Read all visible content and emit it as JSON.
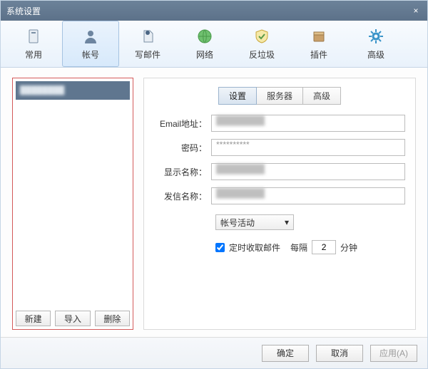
{
  "window": {
    "title": "系统设置",
    "close": "×"
  },
  "toolbar": {
    "items": [
      {
        "label": "常用",
        "icon": "general-icon"
      },
      {
        "label": "帐号",
        "icon": "account-icon",
        "active": true
      },
      {
        "label": "写邮件",
        "icon": "compose-icon"
      },
      {
        "label": "网络",
        "icon": "network-icon"
      },
      {
        "label": "反垃圾",
        "icon": "antispam-icon"
      },
      {
        "label": "插件",
        "icon": "plugin-icon"
      },
      {
        "label": "高级",
        "icon": "advanced-icon"
      }
    ]
  },
  "sidebar": {
    "accounts": [
      {
        "display": "████████"
      }
    ],
    "buttons": {
      "new": "新建",
      "import": "导入",
      "delete": "删除"
    }
  },
  "subtabs": {
    "settings": "设置",
    "server": "服务器",
    "advanced": "高级"
  },
  "form": {
    "email_label": "Email地址：",
    "email_value": "████████",
    "password_label": "密码：",
    "password_value": "**********",
    "displayname_label": "显示名称：",
    "displayname_value": "████████",
    "sender_label": "发信名称：",
    "sender_value": "████████",
    "activity_select": "帐号活动",
    "scheduled_label": "定时收取邮件",
    "interval_prefix": "每隔",
    "interval_value": "2",
    "interval_suffix": "分钟"
  },
  "footer": {
    "ok": "确定",
    "cancel": "取消",
    "apply": "应用(A)"
  },
  "colors": {
    "titlebar": "#5c7189",
    "highlight_border": "#d45a5a"
  }
}
